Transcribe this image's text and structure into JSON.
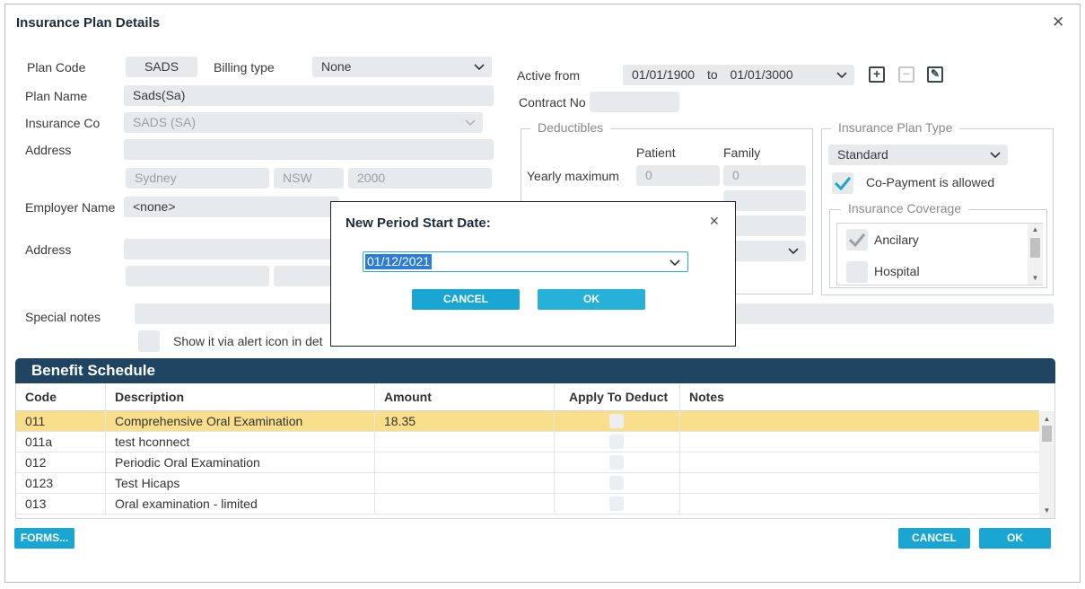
{
  "window": {
    "title": "Insurance Plan Details",
    "close_glyph": "✕"
  },
  "plan": {
    "plan_code_label": "Plan Code",
    "plan_code_value": "SADS",
    "billing_type_label": "Billing type",
    "billing_type_value": "None",
    "plan_name_label": "Plan Name",
    "plan_name_value": "Sads(Sa)",
    "insurance_co_label": "Insurance Co",
    "insurance_co_value": "SADS (SA)",
    "address_label": "Address",
    "address_line1": "",
    "suburb": "Sydney",
    "state": "NSW",
    "postcode": "2000",
    "employer_name_label": "Employer Name",
    "employer_name_value": "<none>",
    "employer_address_label": "Address",
    "special_notes_label": "Special notes",
    "show_alert_label": "Show it via alert icon in det"
  },
  "period": {
    "active_from_label": "Active from",
    "from": "01/01/1900",
    "to_label": "to",
    "to": "01/01/3000",
    "contract_no_label": "Contract No"
  },
  "deductibles": {
    "legend": "Deductibles",
    "col_patient": "Patient",
    "col_family": "Family",
    "yearly_max_label": "Yearly maximum",
    "yearly_max_patient": "0",
    "yearly_max_family": "0"
  },
  "plan_type": {
    "legend": "Insurance Plan Type",
    "value": "Standard",
    "copayment_label": "Co-Payment is allowed",
    "coverage_legend": "Insurance Coverage",
    "coverage_items": [
      {
        "label": "Ancilary",
        "checked": true
      },
      {
        "label": "Hospital",
        "checked": false
      }
    ]
  },
  "benefit_schedule": {
    "title": "Benefit Schedule",
    "columns": [
      "Code",
      "Description",
      "Amount",
      "Apply To Deduct",
      "Notes"
    ],
    "rows": [
      {
        "code": "011",
        "description": "Comprehensive Oral Examination",
        "amount": "18.35",
        "notes": ""
      },
      {
        "code": "011a",
        "description": "test hconnect",
        "amount": "",
        "notes": ""
      },
      {
        "code": "012",
        "description": "Periodic Oral Examination",
        "amount": "",
        "notes": ""
      },
      {
        "code": "0123",
        "description": "Test Hicaps",
        "amount": "",
        "notes": ""
      },
      {
        "code": "013",
        "description": "Oral examination - limited",
        "amount": "",
        "notes": ""
      }
    ]
  },
  "footer": {
    "forms_label": "FORMS...",
    "cancel_label": "CANCEL",
    "ok_label": "OK"
  },
  "modal": {
    "title": "New Period Start Date:",
    "date_value": "01/12/2021",
    "cancel_label": "CANCEL",
    "ok_label": "OK",
    "close_glyph": "✕"
  },
  "colors": {
    "accent": "#1aa6d2",
    "header_bg": "#1f4562",
    "selected_row": "#f9df8c",
    "field_bg": "#e6eaed"
  }
}
